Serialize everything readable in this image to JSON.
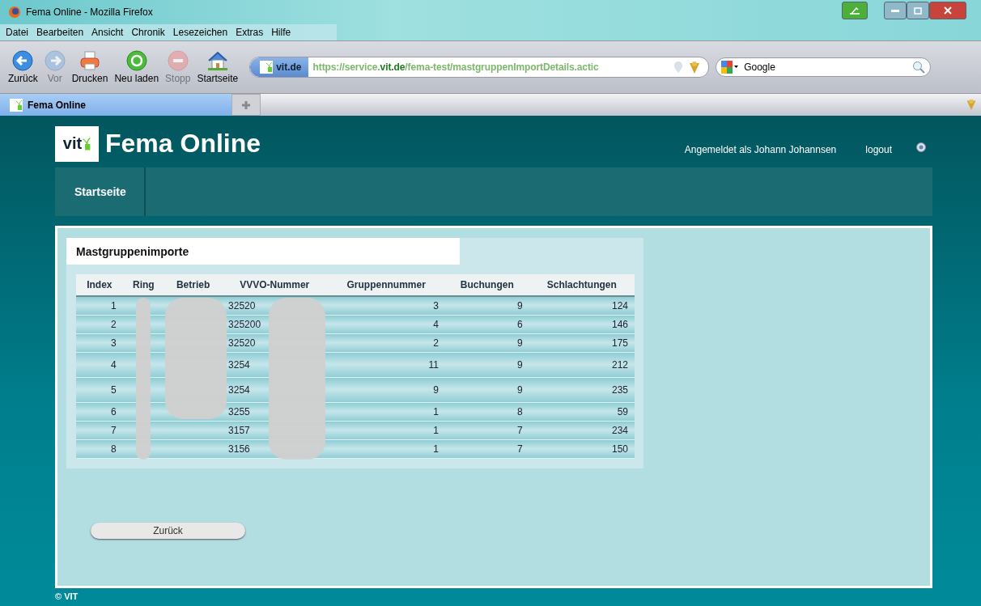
{
  "browser": {
    "title": "Fema Online - Mozilla Firefox",
    "menu": [
      "Datei",
      "Bearbeiten",
      "Ansicht",
      "Chronik",
      "Lesezeichen",
      "Extras",
      "Hilfe"
    ],
    "toolbar": [
      {
        "label": "Zurück",
        "kind": "back",
        "disabled": false
      },
      {
        "label": "Vor",
        "kind": "forward",
        "disabled": true
      },
      {
        "label": "Drucken",
        "kind": "print",
        "disabled": false
      },
      {
        "label": "Neu laden",
        "kind": "reload",
        "disabled": false
      },
      {
        "label": "Stopp",
        "kind": "stop",
        "disabled": true
      },
      {
        "label": "Startseite",
        "kind": "home",
        "disabled": false
      }
    ],
    "site_badge": "vit.de",
    "url": "https://service.**vit.de**/fema-test/mastgruppenImportDetails.actic",
    "search_placeholder": "Google",
    "tabs": [
      {
        "label": "Fema Online",
        "selected": true
      }
    ]
  },
  "page": {
    "logo_text": "vit",
    "brand": "Fema Online",
    "user": "Angemeldet als Johann Johannsen",
    "logout": "logout",
    "nav": [
      "Startseite"
    ],
    "section_title": "Mastgruppenimporte",
    "table": {
      "columns": [
        "Index",
        "Ring",
        "Betrieb",
        "VVVO-Nummer",
        "Gruppennummer",
        "Buchungen",
        "Schlachtungen"
      ],
      "rows": [
        {
          "index": "1",
          "vvvo": "32520",
          "group": "3",
          "bookings": "9",
          "slaughters": "124"
        },
        {
          "index": "2",
          "vvvo": "325200",
          "group": "4",
          "bookings": "6",
          "slaughters": "146"
        },
        {
          "index": "3",
          "vvvo": "32520",
          "group": "2",
          "bookings": "9",
          "slaughters": "175"
        },
        {
          "index": "4",
          "vvvo": "3254",
          "group": "11",
          "bookings": "9",
          "slaughters": "212"
        },
        {
          "index": "5",
          "vvvo": "3254",
          "group": "9",
          "bookings": "9",
          "slaughters": "235"
        },
        {
          "index": "6",
          "vvvo": "3255",
          "group": "1",
          "bookings": "8",
          "slaughters": "59"
        },
        {
          "index": "7",
          "vvvo": "3157",
          "group": "1",
          "bookings": "7",
          "slaughters": "234"
        },
        {
          "index": "8",
          "vvvo": "3156",
          "group": "1",
          "bookings": "7",
          "slaughters": "150"
        }
      ]
    },
    "back_button": "Zurück",
    "footer": "© VIT"
  }
}
